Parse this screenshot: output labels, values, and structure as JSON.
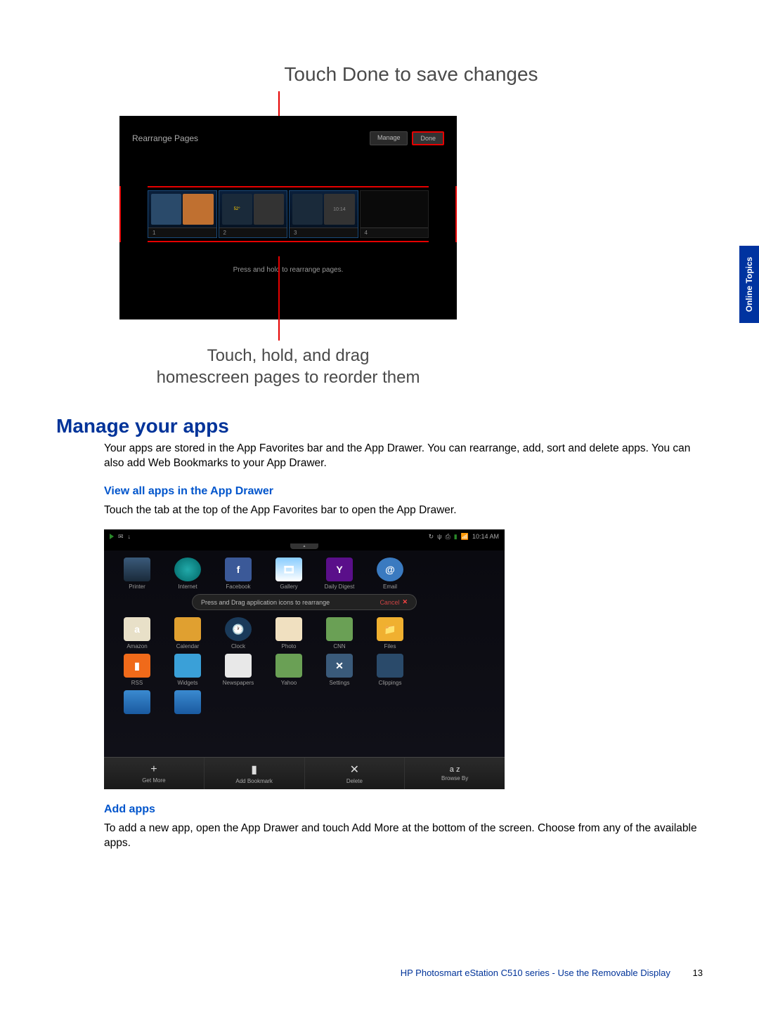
{
  "sideTab": "Online Topics",
  "annotTop": "Touch Done to save changes",
  "annotBottom1": "Touch, hold, and drag",
  "annotBottom2": "homescreen pages to reorder them",
  "ss1": {
    "title": "Rearrange Pages",
    "btnManage": "Manage",
    "btnDone": "Done",
    "hint": "Press and hold to rearrange pages.",
    "pages": [
      "1",
      "2",
      "3",
      "4"
    ],
    "thumb2Temp": "52°",
    "thumb3Clock": "10:14"
  },
  "h1": "Manage your apps",
  "p1": "Your apps are stored in the App Favorites bar and the App Drawer. You can rearrange, add, sort and delete apps. You can also add Web Bookmarks to your App Drawer.",
  "h3a": "View all apps in the App Drawer",
  "p2": "Touch the tab at the top of the App Favorites bar to open the App Drawer.",
  "ss2": {
    "time": "10:14 AM",
    "banner": "Press and Drag application icons to rearrange",
    "cancel": "Cancel",
    "row1": [
      {
        "label": "Printer",
        "cls": "ic-printer",
        "glyph": ""
      },
      {
        "label": "Internet",
        "cls": "ic-internet",
        "glyph": ""
      },
      {
        "label": "Facebook",
        "cls": "ic-fb",
        "glyph": "f"
      },
      {
        "label": "Gallery",
        "cls": "ic-gallery",
        "glyph": "🎞"
      },
      {
        "label": "Daily Digest",
        "cls": "ic-yahoo",
        "glyph": "Y"
      },
      {
        "label": "Email",
        "cls": "ic-email",
        "glyph": "@"
      }
    ],
    "row2": [
      {
        "label": "Amazon",
        "cls": "ic-amazon",
        "glyph": "a"
      },
      {
        "label": "Calendar",
        "cls": "ic-calendar",
        "glyph": ""
      },
      {
        "label": "Clock",
        "cls": "ic-clock",
        "glyph": "🕐"
      },
      {
        "label": "Photo",
        "cls": "ic-photo",
        "glyph": ""
      },
      {
        "label": "CNN",
        "cls": "ic-cnn",
        "glyph": ""
      },
      {
        "label": "Files",
        "cls": "ic-files",
        "glyph": "📁"
      }
    ],
    "row3": [
      {
        "label": "RSS",
        "cls": "ic-rss",
        "glyph": "▮"
      },
      {
        "label": "Widgets",
        "cls": "ic-widgets",
        "glyph": ""
      },
      {
        "label": "Newspapers",
        "cls": "ic-news",
        "glyph": ""
      },
      {
        "label": "Yahoo",
        "cls": "ic-y2",
        "glyph": ""
      },
      {
        "label": "Settings",
        "cls": "ic-settings",
        "glyph": "✕"
      },
      {
        "label": "Clippings",
        "cls": "ic-clip",
        "glyph": ""
      }
    ],
    "row4": [
      {
        "label": "",
        "cls": "ic-gen",
        "glyph": ""
      },
      {
        "label": "",
        "cls": "ic-gen",
        "glyph": ""
      }
    ],
    "bottom": [
      {
        "label": "Get More",
        "glyph": "+"
      },
      {
        "label": "Add Bookmark",
        "glyph": "▮"
      },
      {
        "label": "Delete",
        "glyph": "✕"
      },
      {
        "label": "Browse By",
        "glyph": "a z"
      }
    ]
  },
  "h3b": "Add apps",
  "p3": "To add a new app, open the App Drawer and touch Add More at the bottom of the screen. Choose from any of the available apps.",
  "footerTitle": "HP Photosmart eStation C510 series - Use the Removable Display",
  "footerPage": "13"
}
